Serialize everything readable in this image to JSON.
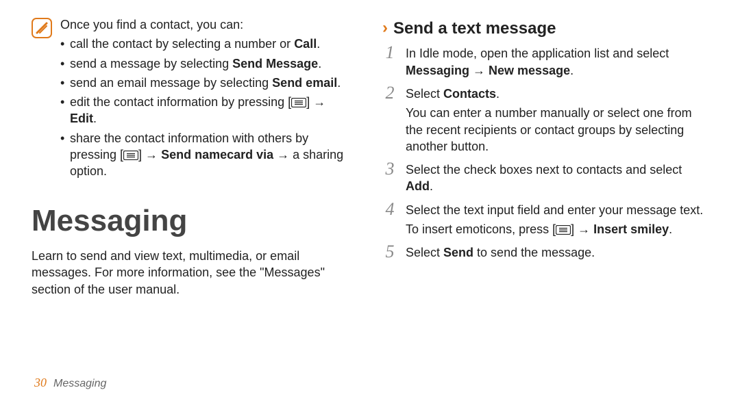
{
  "note": {
    "lead": "Once you find a contact, you can:",
    "items": [
      {
        "pre": "call the contact by selecting a number or ",
        "bold": "Call",
        "post": "."
      },
      {
        "pre": "send a message by selecting ",
        "bold": "Send Message",
        "post": "."
      },
      {
        "pre": "send an email message by selecting ",
        "bold": "Send email",
        "post": "."
      },
      {
        "pre": "edit the contact information by pressing [",
        "menukey": true,
        "mid": "] → ",
        "bold": "Edit",
        "post": "."
      },
      {
        "pre": "share the contact information with others by pressing [",
        "menukey": true,
        "mid": "] → ",
        "bold": "Send namecard via",
        "post": " → a sharing option."
      }
    ]
  },
  "section": {
    "title": "Messaging",
    "lead": "Learn to send and view text, multimedia, or email messages. For more information, see the \"Messages\" section of the user manual."
  },
  "sub": {
    "chevron": "›",
    "title": "Send a text message",
    "steps": [
      {
        "num": "1",
        "parts": [
          {
            "text": "In Idle mode, open the application list and select "
          },
          {
            "bold": "Messaging → New message"
          },
          {
            "text": "."
          }
        ]
      },
      {
        "num": "2",
        "parts": [
          {
            "text": "Select "
          },
          {
            "bold": "Contacts"
          },
          {
            "text": "."
          }
        ],
        "extra": "You can enter a number manually or select one from the recent recipients or contact groups by selecting another button."
      },
      {
        "num": "3",
        "parts": [
          {
            "text": "Select the check boxes next to contacts and select "
          },
          {
            "bold": "Add"
          },
          {
            "text": "."
          }
        ]
      },
      {
        "num": "4",
        "parts": [
          {
            "text": "Select the text input field and enter your message text."
          }
        ],
        "extraParts": [
          {
            "text": "To insert emoticons, press ["
          },
          {
            "menukey": true
          },
          {
            "text": "] → "
          },
          {
            "bold": "Insert smiley"
          },
          {
            "text": "."
          }
        ]
      },
      {
        "num": "5",
        "parts": [
          {
            "text": "Select "
          },
          {
            "bold": "Send"
          },
          {
            "text": " to send the message."
          }
        ]
      }
    ]
  },
  "footer": {
    "page": "30",
    "label": "Messaging"
  }
}
